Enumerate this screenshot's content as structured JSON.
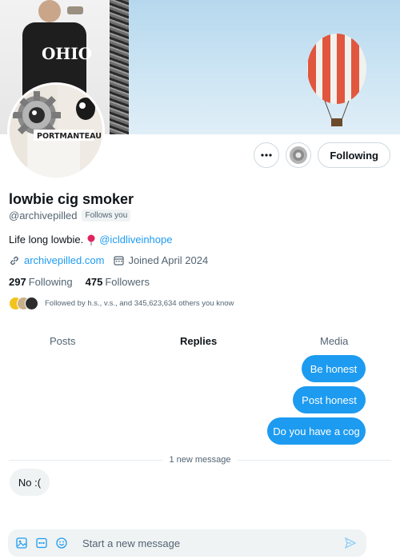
{
  "header": {
    "banner_text": "OHIO",
    "follow_label": "Following"
  },
  "avatar": {
    "tag_text": "PORTMANTEAU"
  },
  "profile": {
    "name": "lowbie cig smoker",
    "handle": "@archivepilled",
    "follows_you": "Follows you",
    "bio_text": "Life long lowbie.",
    "bio_mention": "@icldliveinhope",
    "website": "archivepilled.com",
    "joined": "Joined April 2024",
    "following_count": "297",
    "following_label": "Following",
    "followers_count": "475",
    "followers_label": "Followers",
    "followed_by": "Followed by h.s., v.s., and 345,623,634 others you know"
  },
  "tabs": [
    "Posts",
    "Replies",
    "Media"
  ],
  "messages": {
    "sent": [
      "Be honest",
      "Post honest",
      "Do you have a cog"
    ],
    "divider": "1 new message",
    "received": [
      "No :("
    ]
  },
  "composer": {
    "placeholder": "Start a new message"
  },
  "colors": {
    "accent": "#1d9bf0",
    "text": "#0f1419",
    "muted": "#536471"
  }
}
